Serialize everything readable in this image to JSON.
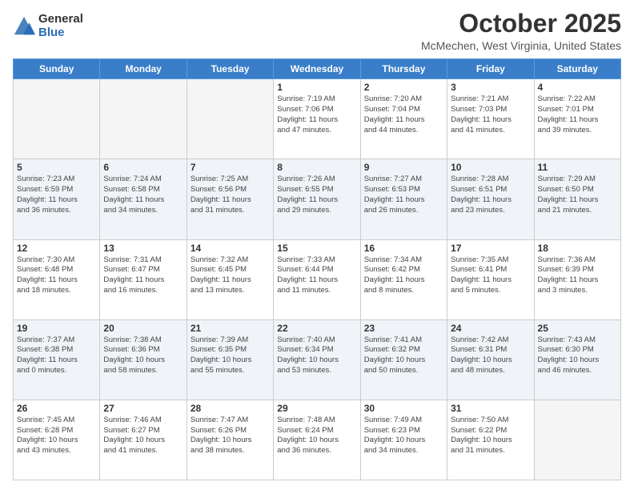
{
  "logo": {
    "general": "General",
    "blue": "Blue"
  },
  "header": {
    "month": "October 2025",
    "location": "McMechen, West Virginia, United States"
  },
  "days_of_week": [
    "Sunday",
    "Monday",
    "Tuesday",
    "Wednesday",
    "Thursday",
    "Friday",
    "Saturday"
  ],
  "weeks": [
    [
      {
        "day": "",
        "info": ""
      },
      {
        "day": "",
        "info": ""
      },
      {
        "day": "",
        "info": ""
      },
      {
        "day": "1",
        "info": "Sunrise: 7:19 AM\nSunset: 7:06 PM\nDaylight: 11 hours\nand 47 minutes."
      },
      {
        "day": "2",
        "info": "Sunrise: 7:20 AM\nSunset: 7:04 PM\nDaylight: 11 hours\nand 44 minutes."
      },
      {
        "day": "3",
        "info": "Sunrise: 7:21 AM\nSunset: 7:03 PM\nDaylight: 11 hours\nand 41 minutes."
      },
      {
        "day": "4",
        "info": "Sunrise: 7:22 AM\nSunset: 7:01 PM\nDaylight: 11 hours\nand 39 minutes."
      }
    ],
    [
      {
        "day": "5",
        "info": "Sunrise: 7:23 AM\nSunset: 6:59 PM\nDaylight: 11 hours\nand 36 minutes."
      },
      {
        "day": "6",
        "info": "Sunrise: 7:24 AM\nSunset: 6:58 PM\nDaylight: 11 hours\nand 34 minutes."
      },
      {
        "day": "7",
        "info": "Sunrise: 7:25 AM\nSunset: 6:56 PM\nDaylight: 11 hours\nand 31 minutes."
      },
      {
        "day": "8",
        "info": "Sunrise: 7:26 AM\nSunset: 6:55 PM\nDaylight: 11 hours\nand 29 minutes."
      },
      {
        "day": "9",
        "info": "Sunrise: 7:27 AM\nSunset: 6:53 PM\nDaylight: 11 hours\nand 26 minutes."
      },
      {
        "day": "10",
        "info": "Sunrise: 7:28 AM\nSunset: 6:51 PM\nDaylight: 11 hours\nand 23 minutes."
      },
      {
        "day": "11",
        "info": "Sunrise: 7:29 AM\nSunset: 6:50 PM\nDaylight: 11 hours\nand 21 minutes."
      }
    ],
    [
      {
        "day": "12",
        "info": "Sunrise: 7:30 AM\nSunset: 6:48 PM\nDaylight: 11 hours\nand 18 minutes."
      },
      {
        "day": "13",
        "info": "Sunrise: 7:31 AM\nSunset: 6:47 PM\nDaylight: 11 hours\nand 16 minutes."
      },
      {
        "day": "14",
        "info": "Sunrise: 7:32 AM\nSunset: 6:45 PM\nDaylight: 11 hours\nand 13 minutes."
      },
      {
        "day": "15",
        "info": "Sunrise: 7:33 AM\nSunset: 6:44 PM\nDaylight: 11 hours\nand 11 minutes."
      },
      {
        "day": "16",
        "info": "Sunrise: 7:34 AM\nSunset: 6:42 PM\nDaylight: 11 hours\nand 8 minutes."
      },
      {
        "day": "17",
        "info": "Sunrise: 7:35 AM\nSunset: 6:41 PM\nDaylight: 11 hours\nand 5 minutes."
      },
      {
        "day": "18",
        "info": "Sunrise: 7:36 AM\nSunset: 6:39 PM\nDaylight: 11 hours\nand 3 minutes."
      }
    ],
    [
      {
        "day": "19",
        "info": "Sunrise: 7:37 AM\nSunset: 6:38 PM\nDaylight: 11 hours\nand 0 minutes."
      },
      {
        "day": "20",
        "info": "Sunrise: 7:38 AM\nSunset: 6:36 PM\nDaylight: 10 hours\nand 58 minutes."
      },
      {
        "day": "21",
        "info": "Sunrise: 7:39 AM\nSunset: 6:35 PM\nDaylight: 10 hours\nand 55 minutes."
      },
      {
        "day": "22",
        "info": "Sunrise: 7:40 AM\nSunset: 6:34 PM\nDaylight: 10 hours\nand 53 minutes."
      },
      {
        "day": "23",
        "info": "Sunrise: 7:41 AM\nSunset: 6:32 PM\nDaylight: 10 hours\nand 50 minutes."
      },
      {
        "day": "24",
        "info": "Sunrise: 7:42 AM\nSunset: 6:31 PM\nDaylight: 10 hours\nand 48 minutes."
      },
      {
        "day": "25",
        "info": "Sunrise: 7:43 AM\nSunset: 6:30 PM\nDaylight: 10 hours\nand 46 minutes."
      }
    ],
    [
      {
        "day": "26",
        "info": "Sunrise: 7:45 AM\nSunset: 6:28 PM\nDaylight: 10 hours\nand 43 minutes."
      },
      {
        "day": "27",
        "info": "Sunrise: 7:46 AM\nSunset: 6:27 PM\nDaylight: 10 hours\nand 41 minutes."
      },
      {
        "day": "28",
        "info": "Sunrise: 7:47 AM\nSunset: 6:26 PM\nDaylight: 10 hours\nand 38 minutes."
      },
      {
        "day": "29",
        "info": "Sunrise: 7:48 AM\nSunset: 6:24 PM\nDaylight: 10 hours\nand 36 minutes."
      },
      {
        "day": "30",
        "info": "Sunrise: 7:49 AM\nSunset: 6:23 PM\nDaylight: 10 hours\nand 34 minutes."
      },
      {
        "day": "31",
        "info": "Sunrise: 7:50 AM\nSunset: 6:22 PM\nDaylight: 10 hours\nand 31 minutes."
      },
      {
        "day": "",
        "info": ""
      }
    ]
  ]
}
